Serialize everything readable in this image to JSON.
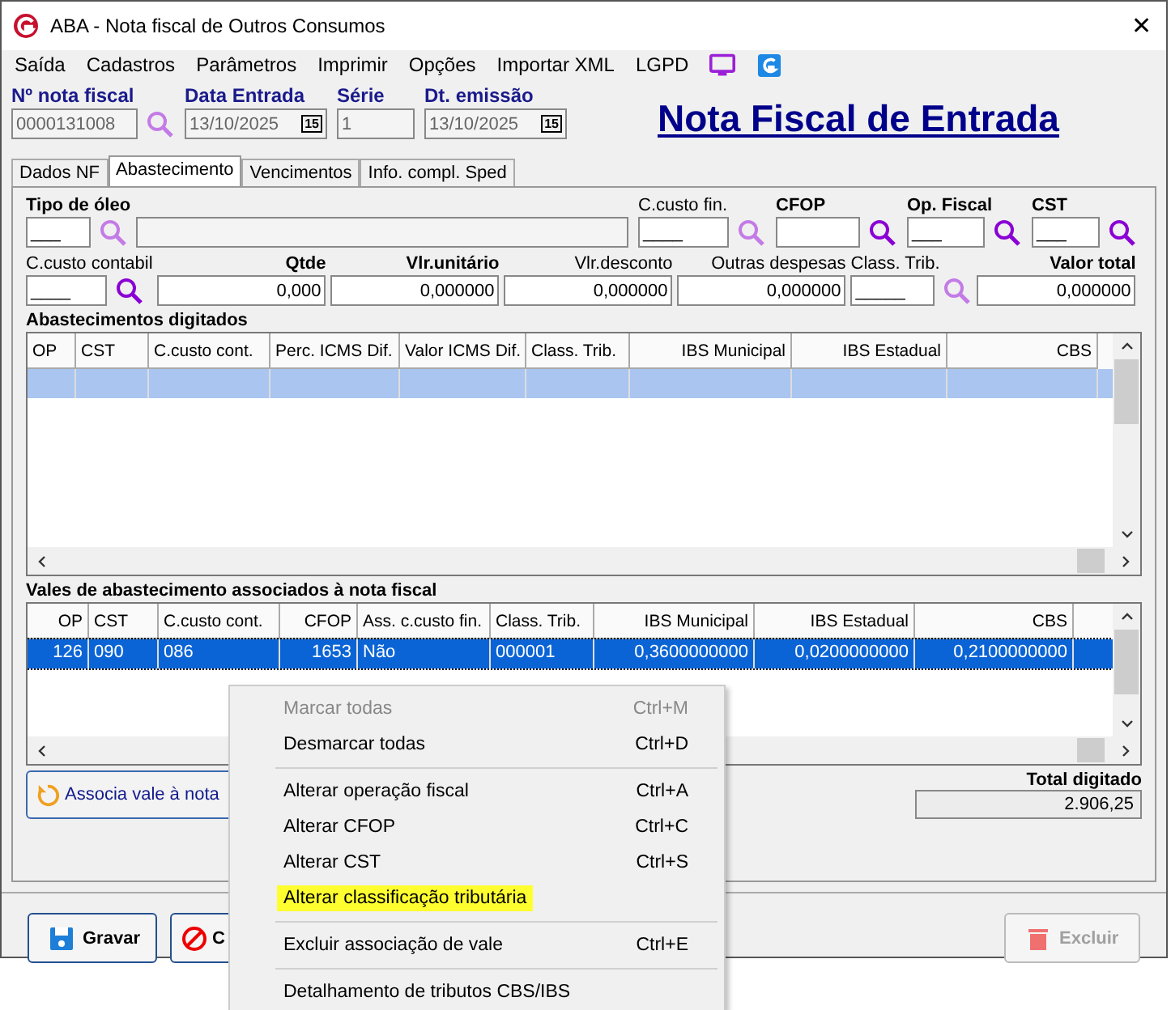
{
  "window": {
    "title": "ABA - Nota fiscal de Outros Consumos",
    "close": "✕"
  },
  "menu": [
    "Saída",
    "Cadastros",
    "Parâmetros",
    "Imprimir",
    "Opções",
    "Importar XML",
    "LGPD"
  ],
  "header_fields": [
    {
      "label": "Nº nota fiscal",
      "value": "0000131008",
      "kind": "search"
    },
    {
      "label": "Data Entrada",
      "value": "13/10/2025",
      "kind": "date",
      "calendar_label": "15"
    },
    {
      "label": "Série",
      "value": "1",
      "kind": "plain"
    },
    {
      "label": "Dt. emissão",
      "value": "13/10/2025",
      "kind": "date",
      "calendar_label": "15"
    }
  ],
  "page_title": "Nota Fiscal de Entrada",
  "tabs": [
    {
      "label": "Dados NF",
      "selected": false
    },
    {
      "label": "Abastecimento",
      "selected": true
    },
    {
      "label": "Vencimentos",
      "selected": false
    },
    {
      "label": "Info. compl. Sped",
      "selected": false
    }
  ],
  "form_row_1": [
    {
      "label": "Tipo de óleo",
      "bold": true,
      "value": "___",
      "kind": "lookup_faded_with_description"
    },
    {
      "label": "C.custo fin.",
      "bold": false,
      "value": "____",
      "kind": "lookup_faded"
    },
    {
      "label": "CFOP",
      "bold": true,
      "kind": "lookup"
    },
    {
      "label": "Op. Fiscal",
      "bold": true,
      "value": "___",
      "kind": "lookup"
    },
    {
      "label": "CST",
      "bold": true,
      "value": "___",
      "kind": "lookup"
    }
  ],
  "form_row_2": [
    {
      "label": "C.custo contabil",
      "bold": false,
      "value": "____",
      "kind": "lookup"
    },
    {
      "label": "Qtde",
      "bold": true,
      "value": "0,000",
      "kind": "number"
    },
    {
      "label": "Vlr.unitário",
      "bold": true,
      "value": "0,000000",
      "kind": "number"
    },
    {
      "label": "Vlr.desconto",
      "bold": false,
      "value": "0,000000",
      "kind": "number"
    },
    {
      "label": "Outras despesas",
      "bold": false,
      "value": "0,000000",
      "kind": "number"
    },
    {
      "label": "Class. Trib.",
      "bold": false,
      "value": "_____",
      "kind": "lookup_faded"
    },
    {
      "label": "Valor total",
      "bold": true,
      "value": "0,000000",
      "kind": "number"
    }
  ],
  "table_1": {
    "title": "Abastecimentos digitados",
    "columns": [
      "OP",
      "CST",
      "C.custo cont.",
      "Perc. ICMS Dif.",
      "Valor ICMS Dif.",
      "Class. Trib.",
      "IBS Municipal",
      "IBS Estadual",
      "CBS"
    ],
    "rows": [
      {
        "cells": [],
        "selected": true,
        "focused": false
      }
    ]
  },
  "table_2": {
    "title": "Vales de abastecimento associados à nota fiscal",
    "columns": [
      "OP",
      "CST",
      "C.custo cont.",
      "CFOP",
      "Ass. c.custo fin.",
      "Class. Trib.",
      "IBS Municipal",
      "IBS Estadual",
      "CBS"
    ],
    "rows": [
      {
        "cells": [
          "126",
          "090",
          "086",
          "1653",
          "Não",
          "000001",
          "0,3600000000",
          "0,0200000000",
          "0,2100000000"
        ],
        "selected": true,
        "focused": true
      }
    ]
  },
  "associate_button": "Associa vale à nota",
  "total": {
    "label": "Total digitado",
    "value": "2.906,25"
  },
  "buttons": [
    {
      "label": "Gravar",
      "kind": "save",
      "disabled": false
    },
    {
      "label": "C",
      "kind": "cancel",
      "disabled": false
    },
    {
      "label": "Excluir",
      "kind": "delete",
      "disabled": true
    }
  ],
  "context_menu": [
    {
      "label": "Marcar todas",
      "shortcut": "Ctrl+M",
      "disabled": true,
      "highlighted": false,
      "separator_after": false
    },
    {
      "label": "Desmarcar todas",
      "shortcut": "Ctrl+D",
      "disabled": false,
      "highlighted": false,
      "separator_after": true
    },
    {
      "label": "Alterar operação fiscal",
      "shortcut": "Ctrl+A",
      "disabled": false,
      "highlighted": false,
      "separator_after": false
    },
    {
      "label": "Alterar CFOP",
      "shortcut": "Ctrl+C",
      "disabled": false,
      "highlighted": false,
      "separator_after": false
    },
    {
      "label": "Alterar CST",
      "shortcut": "Ctrl+S",
      "disabled": false,
      "highlighted": false,
      "separator_after": false
    },
    {
      "label": "Alterar classificação tributária",
      "disabled": false,
      "highlighted": true,
      "separator_after": true
    },
    {
      "label": "Excluir associação de vale",
      "shortcut": "Ctrl+E",
      "disabled": false,
      "highlighted": false,
      "separator_after": true
    },
    {
      "label": "Detalhamento de tributos CBS/IBS",
      "disabled": false,
      "highlighted": false,
      "separator_after": false
    }
  ]
}
